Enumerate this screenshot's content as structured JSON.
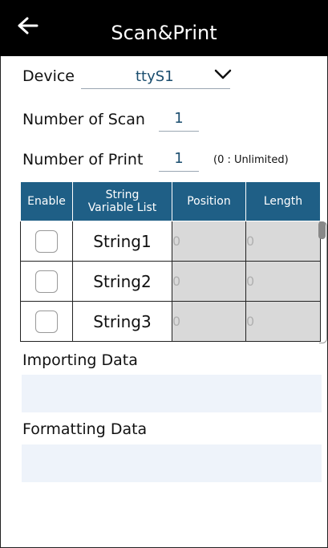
{
  "header": {
    "title": "Scan&Print",
    "back_icon": "arrow-left-icon"
  },
  "device": {
    "label": "Device",
    "value": "ttyS1",
    "dropdown_icon": "chevron-down-icon"
  },
  "scan": {
    "label": "Number of Scan",
    "value": "1"
  },
  "print": {
    "label": "Number of Print",
    "value": "1",
    "hint": "(0 : Unlimited)"
  },
  "table": {
    "headers": [
      "Enable",
      "String\nVariable List",
      "Position",
      "Length"
    ],
    "rows": [
      {
        "name": "String1",
        "position": "0",
        "length": "0"
      },
      {
        "name": "String2",
        "position": "0",
        "length": "0"
      },
      {
        "name": "String3",
        "position": "0",
        "length": "0"
      }
    ]
  },
  "importing": {
    "label": "Importing Data",
    "value": ""
  },
  "formatting": {
    "label": "Formatting Data",
    "value": ""
  },
  "colors": {
    "appbar": "#000000",
    "header_bg": "#1f5f86",
    "accent_text": "#1a4d6e",
    "field_bg": "#eef3fa",
    "disabled_cell": "#d9d9d9"
  }
}
